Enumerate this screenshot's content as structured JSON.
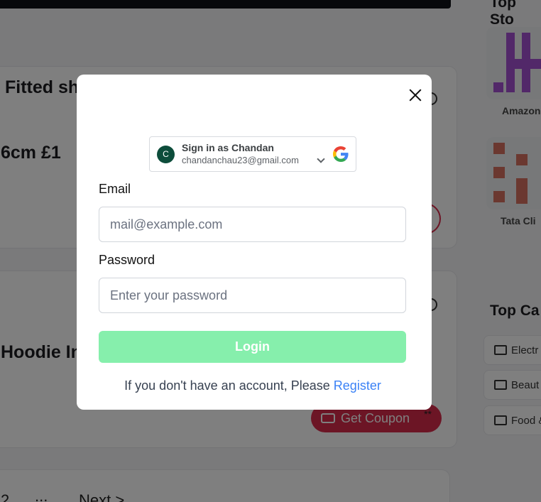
{
  "background": {
    "products": [
      {
        "title_line1": "Fitted sh",
        "title_line2": "6cm £1"
      },
      {
        "title_line1": "Hoodie Inf"
      }
    ],
    "coupon_button_label": "Get Coupon",
    "coupon_suffix": "**",
    "pagination": {
      "page": "2",
      "dots": "...",
      "next": "Next >"
    },
    "sidebar": {
      "top_stores_heading": "Top Sto",
      "stores": [
        {
          "label": "Amazon"
        },
        {
          "label": "Tata Cli"
        }
      ],
      "top_categories_heading": "Top Ca",
      "categories": [
        {
          "label": "Electr"
        },
        {
          "label": "Beaut"
        },
        {
          "label": "Food &"
        }
      ]
    }
  },
  "modal": {
    "google": {
      "avatar_letter": "C",
      "name": "Sign in as Chandan",
      "email": "chandanchau23@gmail.com"
    },
    "email_label": "Email",
    "email_placeholder": "mail@example.com",
    "password_label": "Password",
    "password_placeholder": "Enter your password",
    "login_label": "Login",
    "footer_text": "If you don't have an account, Please ",
    "register_label": "Register"
  },
  "colors": {
    "login_button": "#86efac",
    "register_link": "#3b82f6",
    "coupon_button": "#d92b4b",
    "google_avatar": "#0d4d3b"
  }
}
